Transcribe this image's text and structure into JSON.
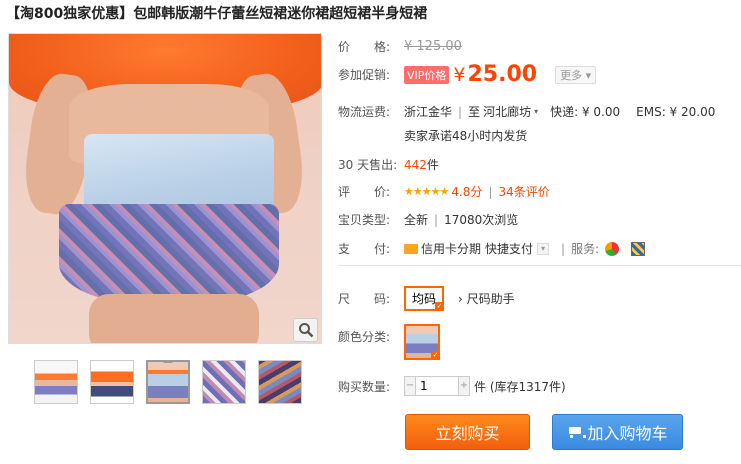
{
  "title": "【淘800独家优惠】包邮韩版潮牛仔蕾丝短裙迷你裙超短裙半身短裙",
  "price": {
    "label": "价　　格:",
    "original": "¥ 125.00"
  },
  "promo": {
    "label": "参加促销:",
    "tag": "VIP价格",
    "currency": "¥",
    "value": "25.00",
    "more": "更多 ▾"
  },
  "shipping": {
    "label": "物流运费:",
    "from": "浙江金华",
    "to": "河北廊坊",
    "express": "快递: ¥ 0.00",
    "ems": "EMS: ¥ 20.00",
    "promise": "卖家承诺48小时内发货"
  },
  "sold": {
    "label": "30 天售出:",
    "count": "442",
    "unit": "件"
  },
  "rating": {
    "label": "评　　价:",
    "stars": "★★★★★",
    "score": "4.8分",
    "reviews": "34条评价"
  },
  "type": {
    "label": "宝贝类型:",
    "condition": "全新",
    "views": "17080次浏览"
  },
  "pay": {
    "label": "支　　付:",
    "method1": "信用卡分期",
    "method2": "快捷支付",
    "services": "服务:"
  },
  "size": {
    "label": "尺　　码:",
    "value": "均码",
    "help": "尺码助手"
  },
  "color": {
    "label": "颜色分类:"
  },
  "quantity": {
    "label": "购买数量:",
    "value": "1",
    "stock": "件 (库存1317件)"
  },
  "buttons": {
    "buy": "立刻购买",
    "cart": "加入购物车"
  },
  "colors": {
    "accent": "#ff4400",
    "buy": "#f25f0d",
    "cart": "#3a8ae0"
  }
}
